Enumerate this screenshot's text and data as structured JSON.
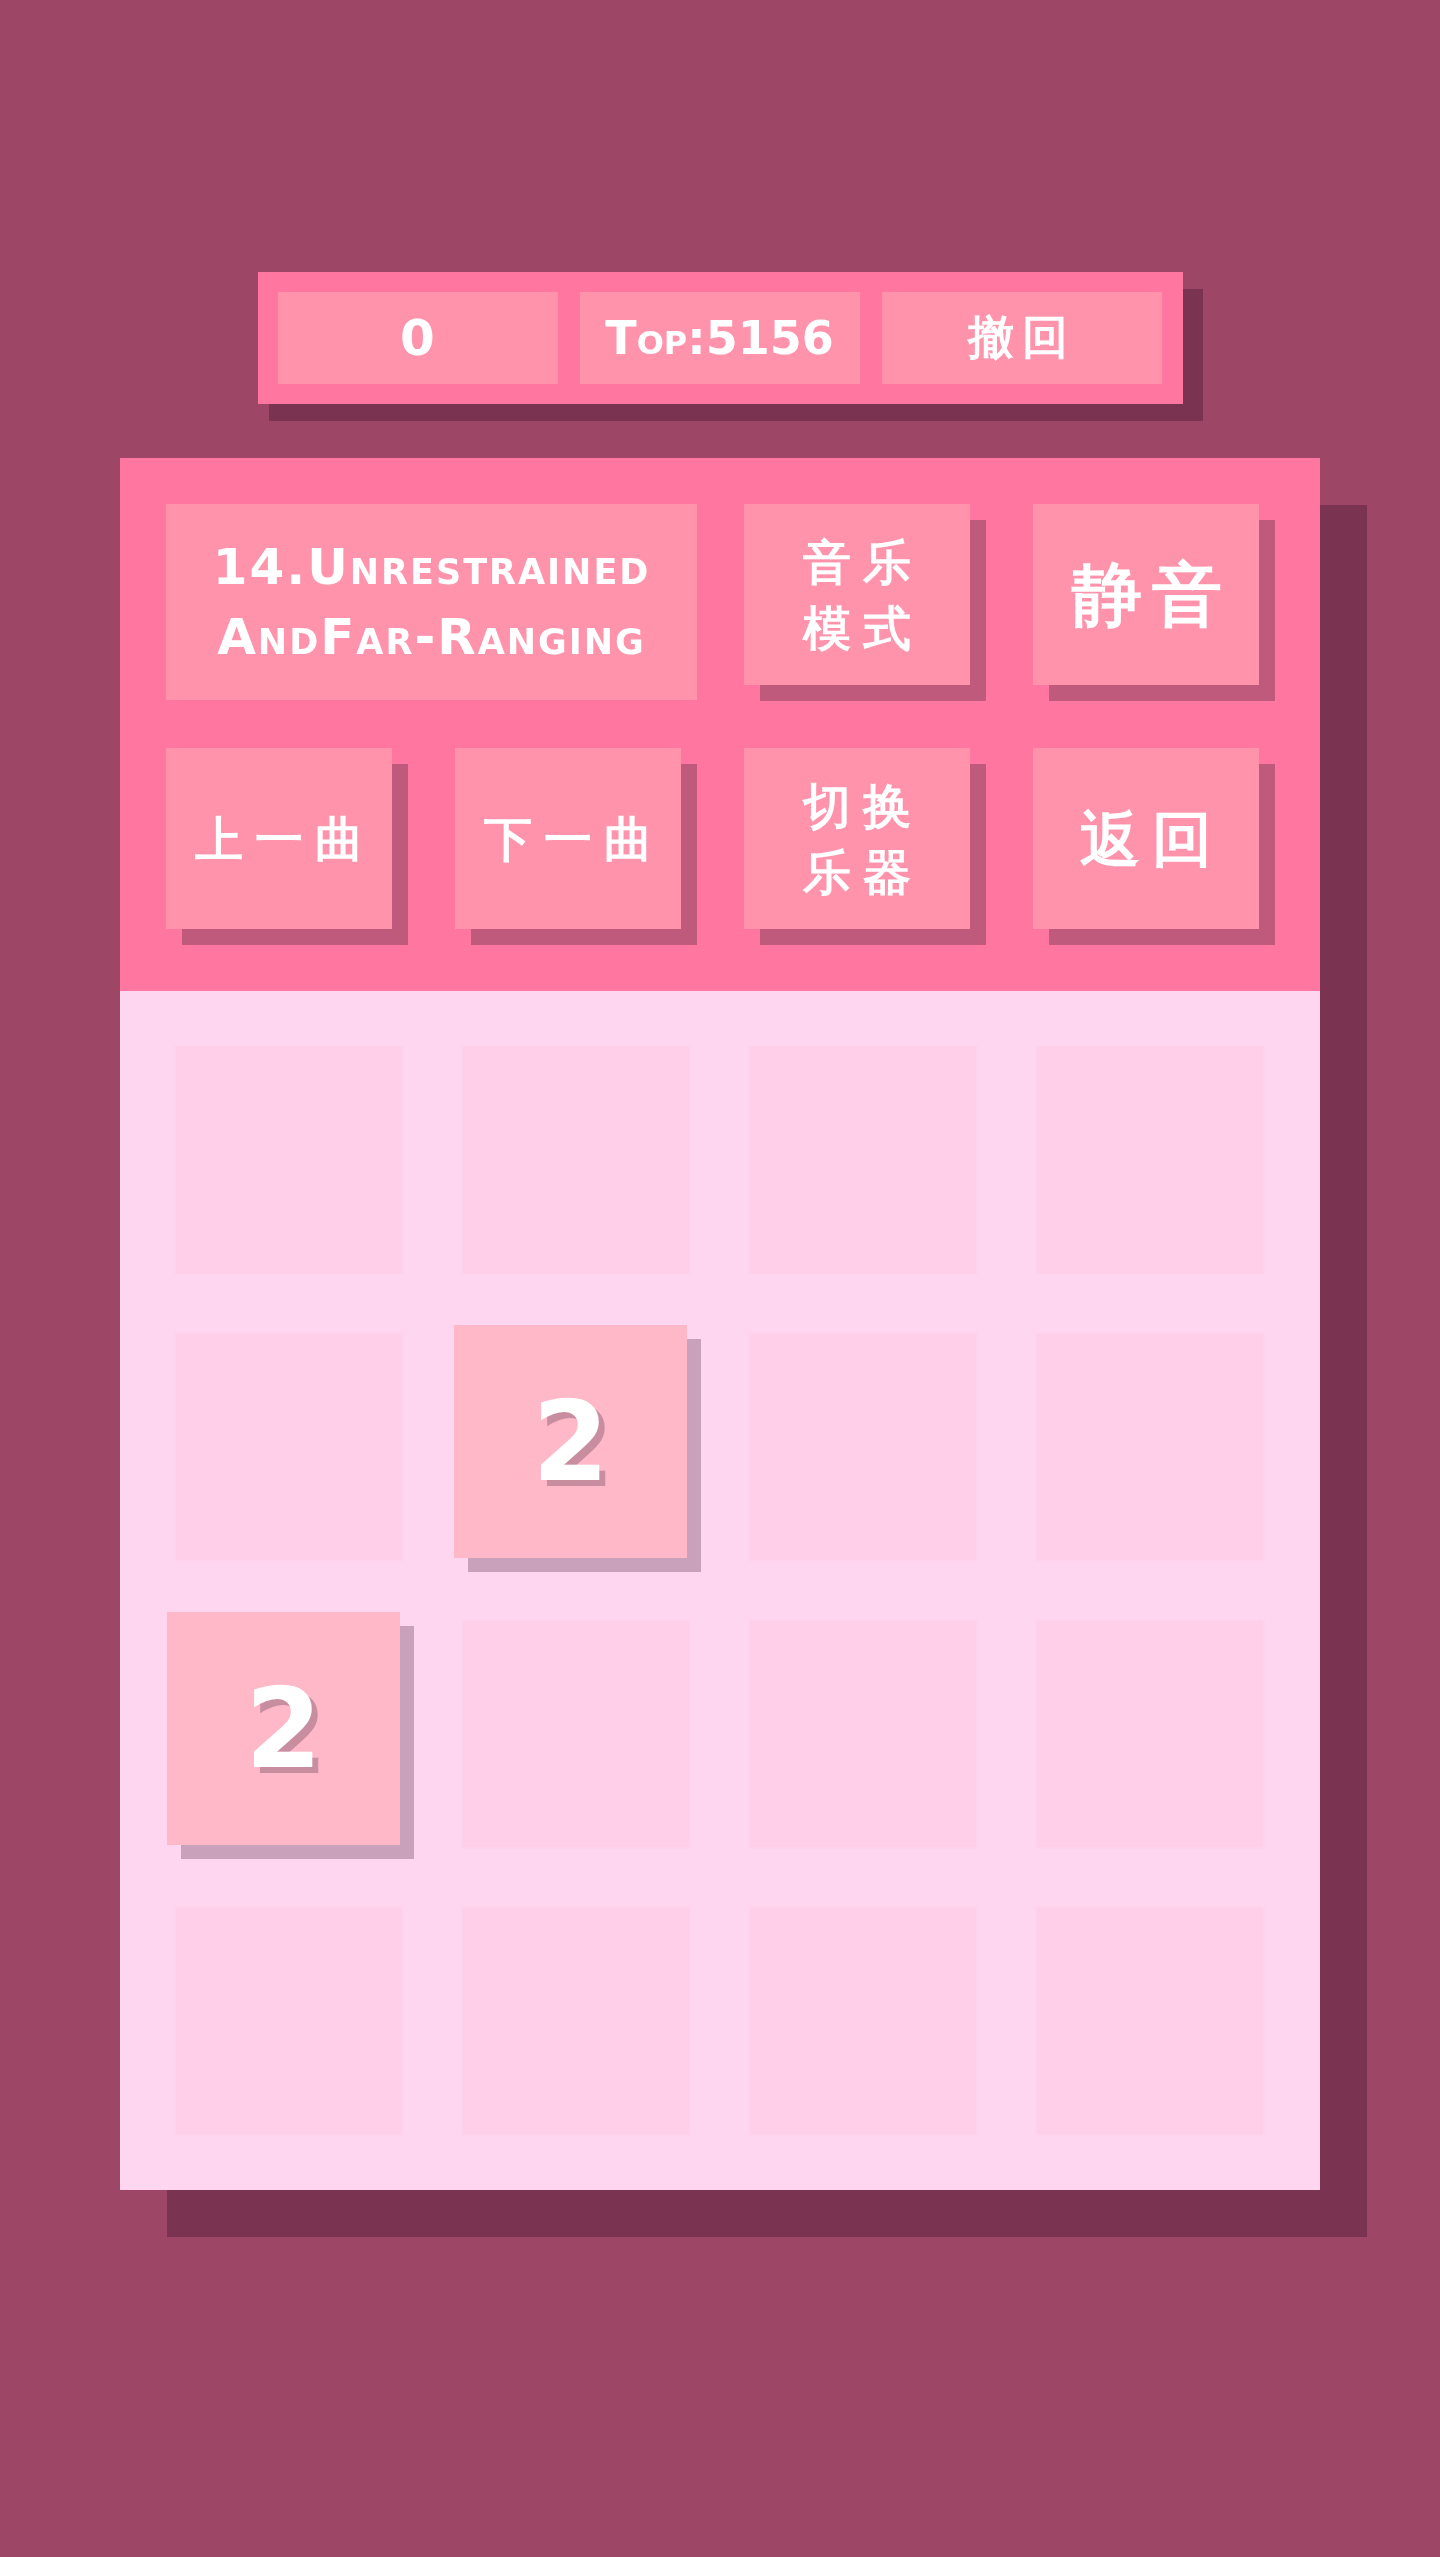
{
  "score_bar": {
    "score": "0",
    "best": "Top:5156",
    "undo_label": "撤回"
  },
  "controls": [
    {
      "kind": "track",
      "label": "14.Unrestrained AndFar-Ranging"
    },
    {
      "kind": "button",
      "label": "音乐模式"
    },
    {
      "kind": "button",
      "label": "静音"
    },
    {
      "kind": "button",
      "label": "上一曲"
    },
    {
      "kind": "button",
      "label": "下一曲"
    },
    {
      "kind": "button",
      "label": "切换乐器"
    },
    {
      "kind": "button",
      "label": "返回"
    }
  ],
  "board": {
    "rows": [
      [
        {
          "kind": "empty"
        },
        {
          "kind": "empty"
        },
        {
          "kind": "empty"
        },
        {
          "kind": "empty"
        }
      ],
      [
        {
          "kind": "empty"
        },
        {
          "kind": "tile",
          "value": "2"
        },
        {
          "kind": "empty"
        },
        {
          "kind": "empty"
        }
      ],
      [
        {
          "kind": "tile",
          "value": "2"
        },
        {
          "kind": "empty"
        },
        {
          "kind": "empty"
        },
        {
          "kind": "empty"
        }
      ],
      [
        {
          "kind": "empty"
        },
        {
          "kind": "empty"
        },
        {
          "kind": "empty"
        },
        {
          "kind": "empty"
        }
      ]
    ]
  }
}
